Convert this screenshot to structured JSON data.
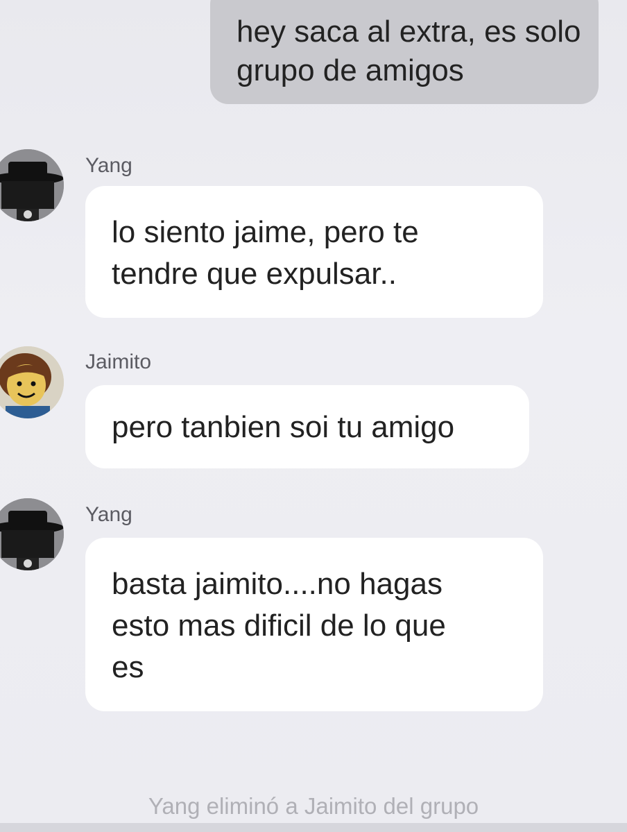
{
  "messages": [
    {
      "direction": "outgoing",
      "lines": [
        "hey saca al extra, es solo",
        "grupo de amigos"
      ]
    },
    {
      "direction": "incoming",
      "sender": "Yang",
      "avatar_icon": "yang-hat-avatar-icon",
      "lines": [
        "lo siento jaime, pero te",
        "tendre que expulsar.."
      ]
    },
    {
      "direction": "incoming",
      "sender": "Jaimito",
      "avatar_icon": "jaimito-face-avatar-icon",
      "lines": [
        "pero tanbien soi tu amigo"
      ]
    },
    {
      "direction": "incoming",
      "sender": "Yang",
      "avatar_icon": "yang-hat-avatar-icon",
      "lines": [
        "basta jaimito....no hagas",
        "esto mas dificil de lo que",
        "es"
      ]
    }
  ],
  "system_message": "Yang eliminó a Jaimito del grupo",
  "colors": {
    "outgoing_bubble": "#c9c9ce",
    "incoming_bubble": "#ffffff",
    "background": "#ececf1",
    "system_text": "#b0b0b6",
    "sender_text": "#5b5b62"
  }
}
